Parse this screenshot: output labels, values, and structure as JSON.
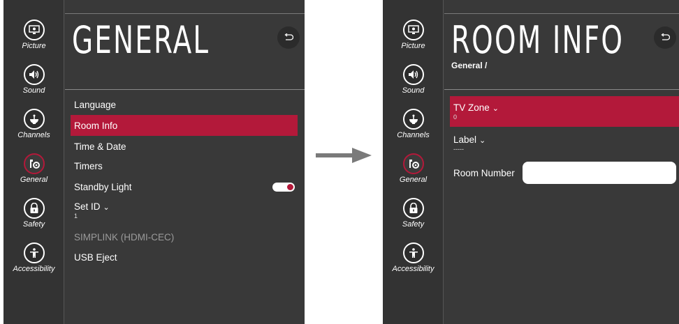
{
  "nav": {
    "items": [
      {
        "label": "Picture",
        "icon": "picture-icon"
      },
      {
        "label": "Sound",
        "icon": "sound-icon"
      },
      {
        "label": "Channels",
        "icon": "channels-icon"
      },
      {
        "label": "General",
        "icon": "general-icon"
      },
      {
        "label": "Safety",
        "icon": "safety-icon"
      },
      {
        "label": "Accessibility",
        "icon": "accessibility-icon"
      }
    ],
    "active": "General"
  },
  "left_screen": {
    "title": "GENERAL",
    "back_icon": "back-icon",
    "menu": [
      {
        "label": "Language"
      },
      {
        "label": "Room Info",
        "selected": true
      },
      {
        "label": "Time & Date"
      },
      {
        "label": "Timers"
      },
      {
        "label": "Standby Light",
        "toggle_on": true
      },
      {
        "label": "Set ID",
        "value": "1"
      },
      {
        "label": "SIMPLINK (HDMI-CEC)",
        "disabled": true
      },
      {
        "label": "USB Eject"
      }
    ]
  },
  "right_screen": {
    "title": "ROOM INFO",
    "breadcrumb": "General /",
    "back_icon": "back-icon",
    "tv_zone": {
      "label": "TV Zone",
      "value": "0"
    },
    "label_field": {
      "label": "Label",
      "value": "-----"
    },
    "room_number": {
      "label": "Room Number",
      "value": ""
    }
  },
  "colors": {
    "accent": "#b3193a",
    "panel": "#393939",
    "sidebar": "#333333",
    "arrow": "#7a7a7a"
  }
}
